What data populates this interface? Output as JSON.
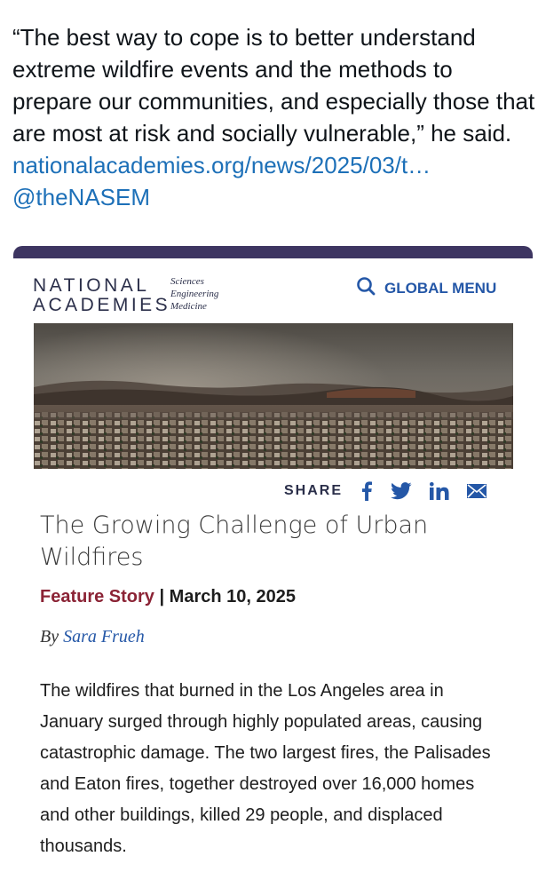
{
  "tweet": {
    "text": "“The best way to cope is to better understand extreme wildfire events and the methods to prepare our communities, and especially those that are most at risk and socially vulnerable,” he said.",
    "link": "nationalacademies.org/news/2025/03/t…",
    "handle": "@theNASEM"
  },
  "card": {
    "logo_line1": "NATIONAL",
    "logo_line2": "ACADEMIES",
    "logo_sub": [
      "Sciences",
      "Engineering",
      "Medicine"
    ],
    "global_menu": "GLOBAL MENU",
    "share_label": "SHARE",
    "share_icons": [
      "facebook-icon",
      "twitter-icon",
      "linkedin-icon",
      "email-icon"
    ],
    "title": "The Growing Challenge of Urban Wildfires",
    "story_type": "Feature Story",
    "separator": "|",
    "date": "March 10, 2025",
    "byline_prefix": "By",
    "author": "Sara Frueh",
    "body": "The wildfires that burned in the Los Angeles area in January surged through highly populated areas, causing catastrophic damage. The two largest fires, the Palisades and Eaton fires, together destroyed over 16,000 homes and other buildings, killed 29 people, and displaced thousands."
  },
  "colors": {
    "link": "#1d70b8",
    "brand_purple": "#3d3561",
    "accent_blue": "#2457a7",
    "story_type": "#8b2335"
  }
}
